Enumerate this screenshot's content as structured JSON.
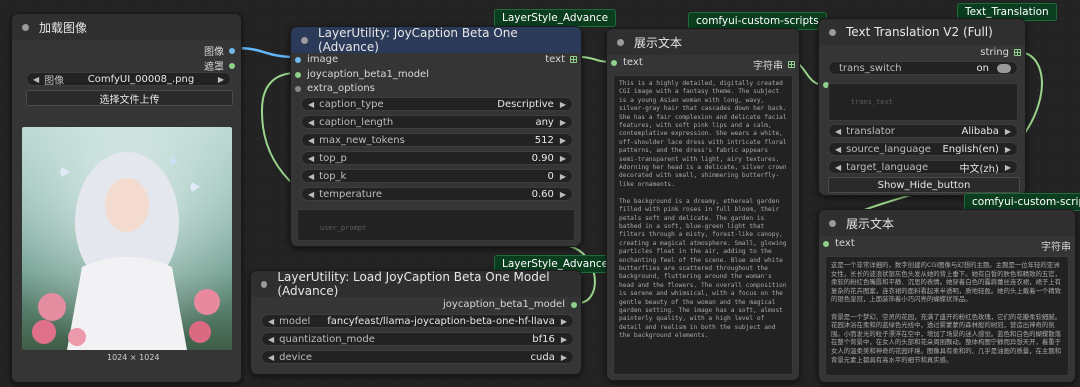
{
  "load_image": {
    "title": "加载图像",
    "output_image": "图像",
    "output_mask": "遮罩",
    "image_widget_label": "图像",
    "image_widget_value": "ComfyUI_00008_.png",
    "upload_button": "选择文件上传",
    "image_size": "1024 × 1024"
  },
  "joycaption": {
    "badge": "LayerStyle_Advance",
    "title": "LayerUtility: JoyCaption Beta One (Advance)",
    "input_image": "image",
    "input_model": "joycaption_beta1_model",
    "input_extra": "extra_options",
    "output_text": "text",
    "widgets": [
      {
        "label": "caption_type",
        "value": "Descriptive"
      },
      {
        "label": "caption_length",
        "value": "any"
      },
      {
        "label": "max_new_tokens",
        "value": "512"
      },
      {
        "label": "top_p",
        "value": "0.90"
      },
      {
        "label": "top_k",
        "value": "0"
      },
      {
        "label": "temperature",
        "value": "0.60"
      }
    ],
    "user_prompt_placeholder": "user_prompt"
  },
  "load_model": {
    "badge": "LayerStyle_Advance",
    "title": "LayerUtility: Load JoyCaption Beta One Model (Advance)",
    "output": "joycaption_beta1_model",
    "widgets": [
      {
        "label": "model",
        "value": "fancyfeast/llama-joycaption-beta-one-hf-llava"
      },
      {
        "label": "quantization_mode",
        "value": "bf16"
      },
      {
        "label": "device",
        "value": "cuda"
      }
    ]
  },
  "show_text_1": {
    "badge": "comfyui-custom-scripts",
    "title": "展示文本",
    "input": "text",
    "output": "字符串",
    "content": "This is a highly detailed, digitally created CGI image with a fantasy theme. The subject is a young Asian woman with long, wavy, silver-gray hair that cascades down her back. She has a fair complexion and delicate facial features, with soft pink lips and a calm, contemplative expression. She wears a white, off-shoulder lace dress with intricate floral patterns, and the dress's fabric appears semi-transparent with light, airy textures. Adorning her head is a delicate, silver crown decorated with small, shimmering butterfly-like ornaments.\n\nThe background is a dreamy, ethereal garden filled with pink roses in full bloom, their petals soft and delicate. The garden is bathed in a soft, blue-green light that filters through a misty, forest-like canopy, creating a magical atmosphere. Small, glowing particles float in the air, adding to the enchanting feel of the scene. Blue and white butterflies are scattered throughout the background, fluttering around the woman's head and the flowers. The overall composition is serene and whimsical, with a focus on the gentle beauty of the woman and the magical garden setting. The image has a soft, almost painterly quality, with a high level of detail and realism in both the subject and the background elements."
  },
  "translation": {
    "badge": "Text_Translation",
    "title": "Text Translation V2 (Full)",
    "output": "string",
    "toggle_label": "trans_switch",
    "toggle_value": "on",
    "text_placeholder": "trans_text",
    "widgets": [
      {
        "label": "translator",
        "value": "Alibaba"
      },
      {
        "label": "source_language",
        "value": "English(en)"
      },
      {
        "label": "target_language",
        "value": "中文(zh)"
      }
    ],
    "button": "Show_Hide_button"
  },
  "show_text_2": {
    "badge": "comfyui-custom-scripts",
    "title": "展示文本",
    "input": "text",
    "output": "字符串",
    "content": "这是一个非常详细的，数字创建的CGI图像与幻想的主题。主题是一位年轻的亚洲女性，长长的波浪状银灰色头发从她的背上垂下。她有白皙的肤色和精致的五官，柔软的粉红色嘴唇和平静、沉思的表情。她穿着白色的露肩蕾丝连衣裙，裙子上有复杂的花卉图案，连衣裙的面料看起来半透明，质地轻盈。她的头上戴着一个精致的银色皇冠，上面装饰着小巧闪亮的蝴蝶状饰品。\n\n背景是一个梦幻、空灵的花园，充满了盛开的粉红色玫瑰，它们的花瓣柔软细腻。花园沐浴在柔和的蓝绿色光线中，透过雾蒙蒙的森林般的树冠，营造出神奇的氛围。小而发光的粒子漂浮在空中，增加了场景的迷人感觉。蓝色和白色的蝴蝶散落在整个背景中，在女人的头部和花朵周围飘动。整体构图宁静而异想天开，着重于女人的温柔美和神奇的花园环境。图像具有柔和的、几乎是油画的质量，在主题和背景元素上都具有高水平的细节和真实感。"
  }
}
